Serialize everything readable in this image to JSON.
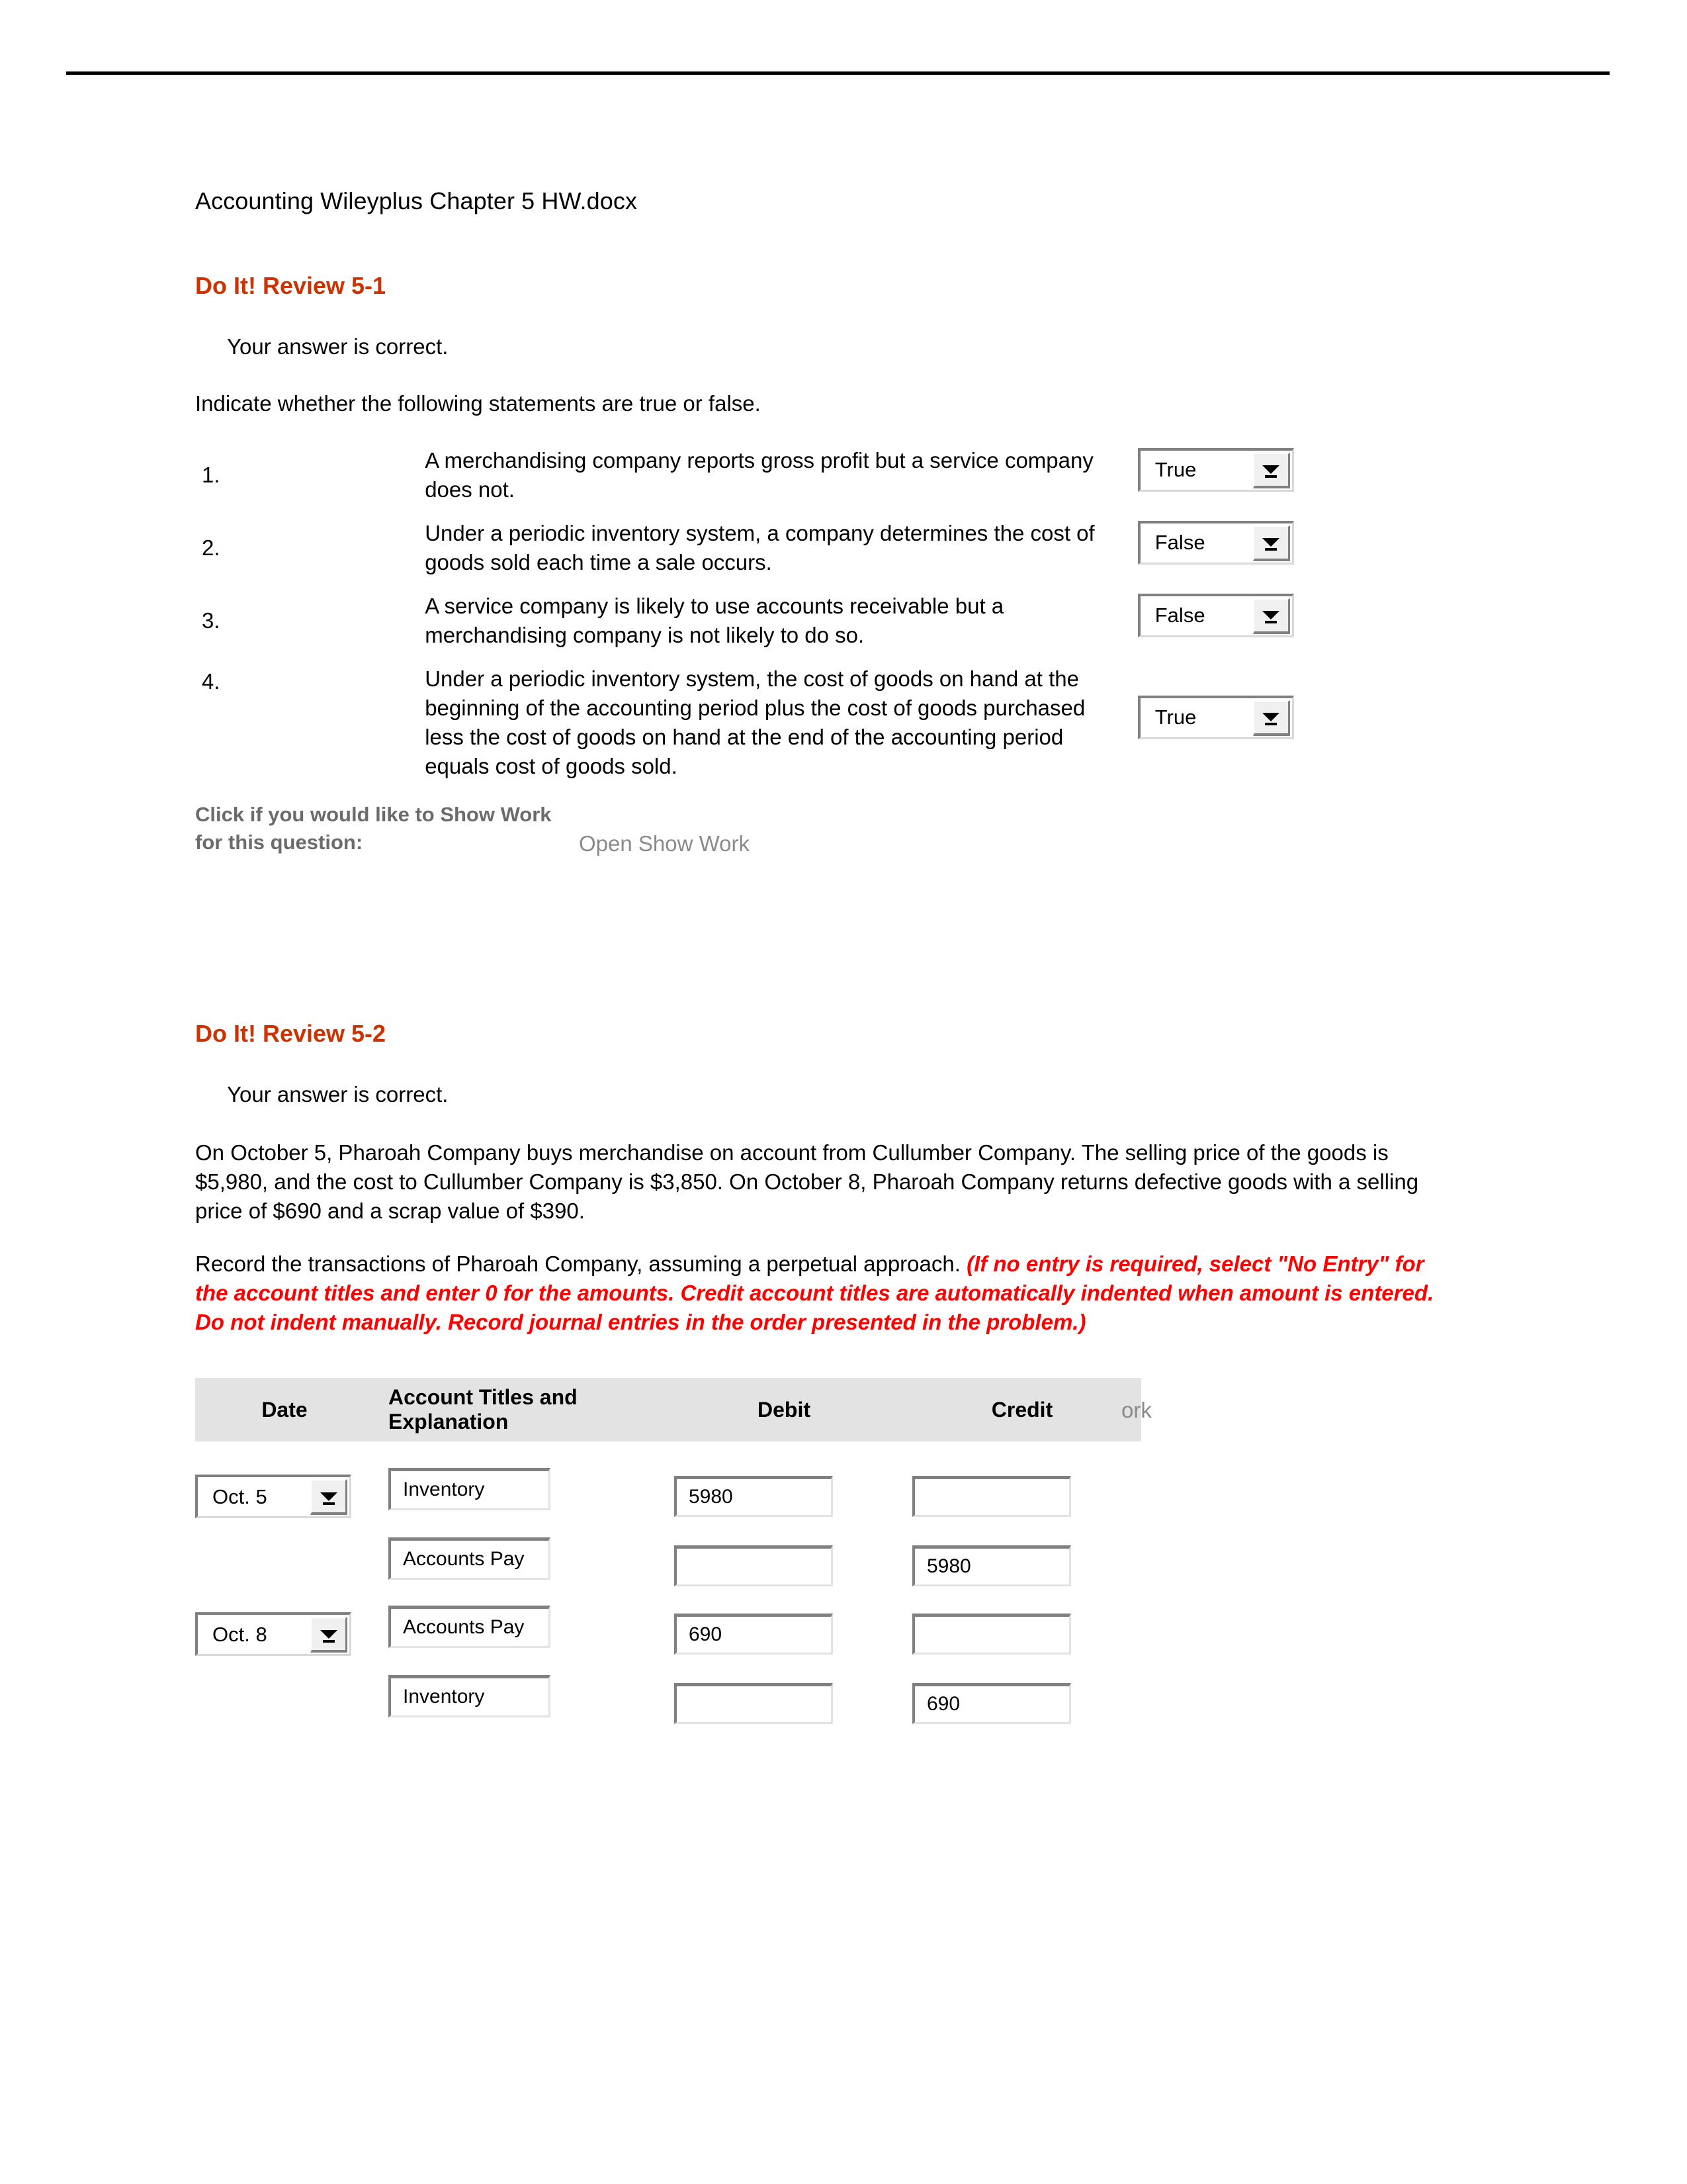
{
  "document": {
    "title": "Accounting Wileyplus Chapter 5 HW.docx"
  },
  "colors": {
    "heading_orange": "#CC3300",
    "instruction_red": "#FF0000",
    "showwork_gray": "#6b6b6b",
    "link_gray": "#8a8a8a",
    "table_header_bg": "#e3e3e3"
  },
  "review_5_1": {
    "heading": "Do It! Review 5-1",
    "answer_note": "Your answer is correct.",
    "prompt": "Indicate whether the following statements are true or false.",
    "statements": [
      {
        "number": "1.",
        "text": "A merchandising company reports gross profit but a service company does not.",
        "answer": "True"
      },
      {
        "number": "2.",
        "text": "Under a periodic inventory system, a company determines the cost of goods sold each time a sale occurs.",
        "answer": "False"
      },
      {
        "number": "3.",
        "text": "A service company is likely to use accounts receivable but a merchandising company is not likely to do so.",
        "answer": "False"
      },
      {
        "number": "4.",
        "text": "Under a periodic inventory system, the cost of goods on hand at the beginning of the accounting period plus the cost of goods purchased less the cost of goods on hand at the end of the accounting period equals cost of goods sold.",
        "answer": "True"
      }
    ],
    "show_work": {
      "label": "Click if you would like to Show Work for this question:",
      "link": "Open Show Work"
    }
  },
  "review_5_2": {
    "heading": "Do It! Review 5-2",
    "answer_note": "Your answer is correct.",
    "problem": "On October 5, Pharoah Company buys merchandise on account from Cullumber Company. The selling price of the goods is $5,980, and the cost to Cullumber Company is $3,850. On October 8, Pharoah Company returns defective goods with a selling price of $690 and a scrap value of $390.",
    "instruction_plain": "Record the transactions of Pharoah Company, assuming a perpetual approach. ",
    "instruction_red": "(If no entry is required, select \"No Entry\" for the account titles and enter 0 for the amounts. Credit account titles are automatically indented when amount is entered. Do not indent manually. Record journal entries in the order presented in the problem.)",
    "show_work_partial": "ork",
    "journal": {
      "columns": [
        "Date",
        "Account Titles and Explanation",
        "Debit",
        "Credit"
      ],
      "rows": [
        {
          "date": "Oct. 5",
          "account": "Inventory",
          "debit": "5980",
          "credit": ""
        },
        {
          "date": "",
          "account": "Accounts Pay",
          "debit": "",
          "credit": "5980"
        },
        {
          "date": "Oct. 8",
          "account": "Accounts Pay",
          "debit": "690",
          "credit": ""
        },
        {
          "date": "",
          "account": "Inventory",
          "debit": "",
          "credit": "690"
        }
      ]
    }
  }
}
